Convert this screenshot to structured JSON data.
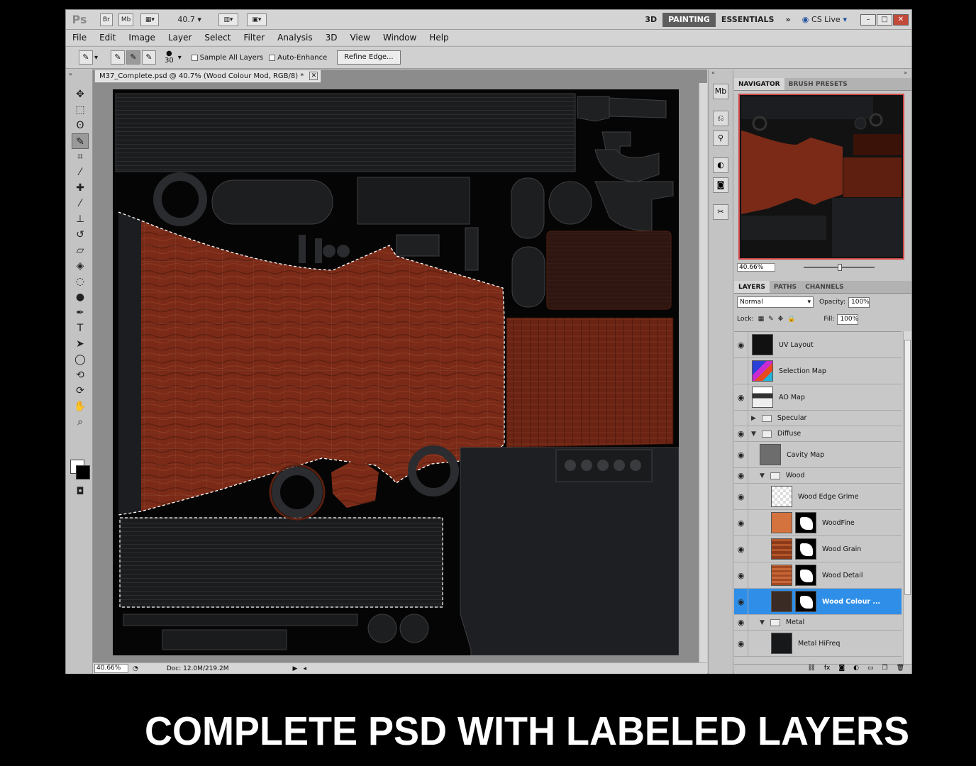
{
  "appbar": {
    "logo": "Ps",
    "bridge": "Br",
    "minibridge": "Mb",
    "zoom": "40.7",
    "workspaces": [
      "3D",
      "PAINTING",
      "ESSENTIALS"
    ],
    "active_workspace": "PAINTING",
    "more": "»",
    "cslive": "CS Live"
  },
  "menubar": [
    "File",
    "Edit",
    "Image",
    "Layer",
    "Select",
    "Filter",
    "Analysis",
    "3D",
    "View",
    "Window",
    "Help"
  ],
  "options": {
    "brush_size": "30",
    "sample_all_layers": "Sample All Layers",
    "auto_enhance": "Auto-Enhance",
    "refine_edge": "Refine Edge..."
  },
  "document": {
    "tab_title": "M37_Complete.psd @ 40.7% (Wood Colour Mod, RGB/8) *",
    "status_zoom": "40.66%",
    "status_doc": "Doc: 12.0M/219.2M"
  },
  "navigator": {
    "tabs": [
      "NAVIGATOR",
      "BRUSH PRESETS"
    ],
    "zoom": "40.66%"
  },
  "layers_panel": {
    "tabs": [
      "LAYERS",
      "PATHS",
      "CHANNELS"
    ],
    "blend_mode": "Normal",
    "opacity_label": "Opacity:",
    "opacity": "100%",
    "lock_label": "Lock:",
    "fill_label": "Fill:",
    "fill": "100%",
    "layers": [
      {
        "name": "UV Layout",
        "visible": true
      },
      {
        "name": "Selection Map",
        "visible": false
      },
      {
        "name": "AO Map",
        "visible": true
      },
      {
        "name": "Specular",
        "visible": false
      },
      {
        "name": "Diffuse",
        "visible": true
      },
      {
        "name": "Cavity Map",
        "visible": true
      },
      {
        "name": "Wood",
        "visible": true
      },
      {
        "name": "Wood Edge Grime",
        "visible": true
      },
      {
        "name": "WoodFine",
        "visible": true
      },
      {
        "name": "Wood Grain",
        "visible": true
      },
      {
        "name": "Wood Detail",
        "visible": true
      },
      {
        "name": "Wood Colour ...",
        "visible": true
      },
      {
        "name": "Metal",
        "visible": true
      },
      {
        "name": "Metal HiFreq",
        "visible": true
      }
    ],
    "footer": "fx"
  },
  "caption": "COMPLETE PSD WITH LABELED LAYERS",
  "colors": {
    "wood": "#7a2a17",
    "selection": "#2f8fe8",
    "nav_frame": "#d24848"
  }
}
